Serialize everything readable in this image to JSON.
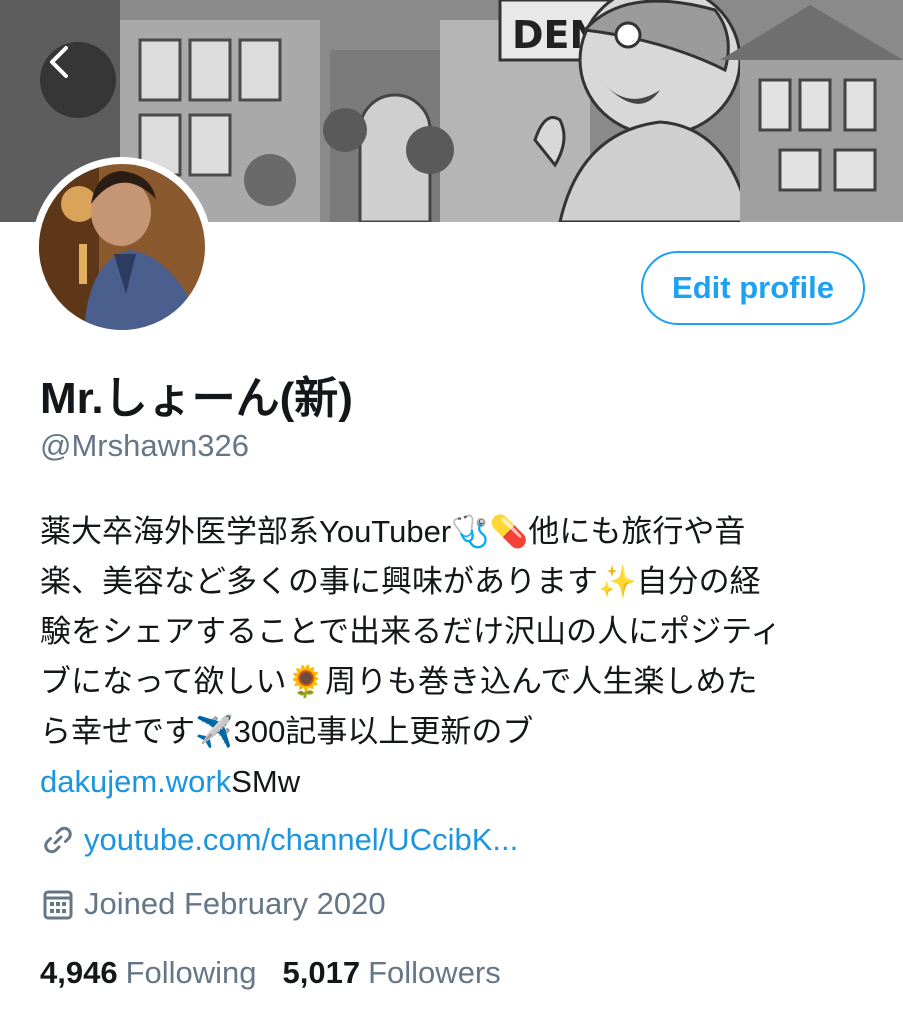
{
  "header": {
    "back_icon": "chevron-left-icon",
    "banner_sign_text": "DEN"
  },
  "profile": {
    "avatar": "avatar",
    "edit_button_label": "Edit profile",
    "display_name": "Mr.しょーん(新)",
    "handle": "@Mrshawn326",
    "bio_lines": [
      {
        "text": "薬大卒海外医学部系YouTuber",
        "emoji": "🩺💊",
        "rest": "他にも旅行や音"
      },
      {
        "text": "楽、美容など多くの事に興味があります",
        "emoji": "✨",
        "rest": "自分の経"
      },
      {
        "text": "験をシェアすることで出来るだけ沢山の人にポジティ"
      },
      {
        "text": "ブになって欲しい",
        "emoji": "🌻",
        "rest": "周りも巻き込んで人生楽しめた"
      },
      {
        "text": "ら幸せです",
        "emoji": "✈️",
        "rest": "300記事以上更新のブ"
      }
    ],
    "bio_link": "dakujem.work",
    "bio_link_suffix": "SMw",
    "website": "youtube.com/channel/UCcibK...",
    "website_icon": "link-icon",
    "joined": "Joined February 2020",
    "joined_icon": "calendar-icon",
    "following_count": "4,946",
    "following_label": "Following",
    "followers_count": "5,017",
    "followers_label": "Followers"
  },
  "colors": {
    "accent": "#1da1f2",
    "link": "#1b95e0",
    "secondary_text": "#657786",
    "primary_text": "#14171a"
  }
}
